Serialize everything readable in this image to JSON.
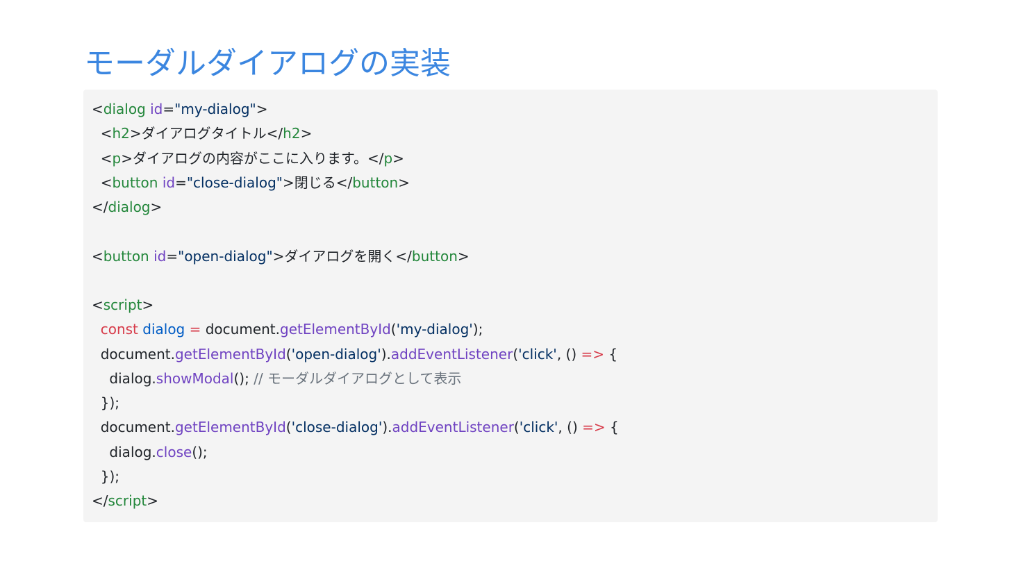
{
  "title": "モーダルダイアログの実装",
  "colors": {
    "title": "#3b86e0",
    "panel_background": "#f4f4f4",
    "plain": "#1f2328",
    "tag": "#22863a",
    "attr": "#6f42c1",
    "string": "#032f62",
    "keyword": "#d73a49",
    "variable": "#005cc5",
    "function": "#6f42c1",
    "comment": "#6a737d"
  },
  "code": {
    "language": "html",
    "lines": [
      [
        [
          "plain",
          "<"
        ],
        [
          "tag",
          "dialog"
        ],
        [
          "plain",
          " "
        ],
        [
          "attr",
          "id"
        ],
        [
          "plain",
          "="
        ],
        [
          "str",
          "\"my-dialog\""
        ],
        [
          "plain",
          ">"
        ]
      ],
      [
        [
          "plain",
          "  <"
        ],
        [
          "tag",
          "h2"
        ],
        [
          "plain",
          ">ダイアログタイトル</"
        ],
        [
          "tag",
          "h2"
        ],
        [
          "plain",
          ">"
        ]
      ],
      [
        [
          "plain",
          "  <"
        ],
        [
          "tag",
          "p"
        ],
        [
          "plain",
          ">ダイアログの内容がここに入ります。</"
        ],
        [
          "tag",
          "p"
        ],
        [
          "plain",
          ">"
        ]
      ],
      [
        [
          "plain",
          "  <"
        ],
        [
          "tag",
          "button"
        ],
        [
          "plain",
          " "
        ],
        [
          "attr",
          "id"
        ],
        [
          "plain",
          "="
        ],
        [
          "str",
          "\"close-dialog\""
        ],
        [
          "plain",
          ">閉じる</"
        ],
        [
          "tag",
          "button"
        ],
        [
          "plain",
          ">"
        ]
      ],
      [
        [
          "plain",
          "</"
        ],
        [
          "tag",
          "dialog"
        ],
        [
          "plain",
          ">"
        ]
      ],
      [],
      [
        [
          "plain",
          "<"
        ],
        [
          "tag",
          "button"
        ],
        [
          "plain",
          " "
        ],
        [
          "attr",
          "id"
        ],
        [
          "plain",
          "="
        ],
        [
          "str",
          "\"open-dialog\""
        ],
        [
          "plain",
          ">ダイアログを開く</"
        ],
        [
          "tag",
          "button"
        ],
        [
          "plain",
          ">"
        ]
      ],
      [],
      [
        [
          "plain",
          "<"
        ],
        [
          "tag",
          "script"
        ],
        [
          "plain",
          ">"
        ]
      ],
      [
        [
          "plain",
          "  "
        ],
        [
          "keyword",
          "const"
        ],
        [
          "plain",
          " "
        ],
        [
          "var",
          "dialog"
        ],
        [
          "plain",
          " "
        ],
        [
          "keyword",
          "="
        ],
        [
          "plain",
          " document."
        ],
        [
          "func",
          "getElementById"
        ],
        [
          "plain",
          "("
        ],
        [
          "str",
          "'my-dialog'"
        ],
        [
          "plain",
          ");"
        ]
      ],
      [
        [
          "plain",
          "  document."
        ],
        [
          "func",
          "getElementById"
        ],
        [
          "plain",
          "("
        ],
        [
          "str",
          "'open-dialog'"
        ],
        [
          "plain",
          ")."
        ],
        [
          "func",
          "addEventListener"
        ],
        [
          "plain",
          "("
        ],
        [
          "str",
          "'click'"
        ],
        [
          "plain",
          ", () "
        ],
        [
          "keyword",
          "=>"
        ],
        [
          "plain",
          " {"
        ]
      ],
      [
        [
          "plain",
          "    dialog."
        ],
        [
          "func",
          "showModal"
        ],
        [
          "plain",
          "(); "
        ],
        [
          "comment",
          "// モーダルダイアログとして表示"
        ]
      ],
      [
        [
          "plain",
          "  });"
        ]
      ],
      [
        [
          "plain",
          "  document."
        ],
        [
          "func",
          "getElementById"
        ],
        [
          "plain",
          "("
        ],
        [
          "str",
          "'close-dialog'"
        ],
        [
          "plain",
          ")."
        ],
        [
          "func",
          "addEventListener"
        ],
        [
          "plain",
          "("
        ],
        [
          "str",
          "'click'"
        ],
        [
          "plain",
          ", () "
        ],
        [
          "keyword",
          "=>"
        ],
        [
          "plain",
          " {"
        ]
      ],
      [
        [
          "plain",
          "    dialog."
        ],
        [
          "func",
          "close"
        ],
        [
          "plain",
          "();"
        ]
      ],
      [
        [
          "plain",
          "  });"
        ]
      ],
      [
        [
          "plain",
          "</"
        ],
        [
          "tag",
          "script"
        ],
        [
          "plain",
          ">"
        ]
      ]
    ]
  }
}
